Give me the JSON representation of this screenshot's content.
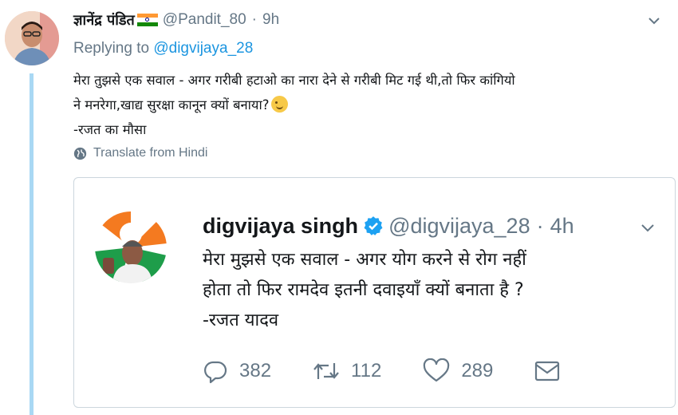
{
  "reply": {
    "author_name": "ज्ञानेंद्र पंडित",
    "handle": "@Pandit_80",
    "separator": "·",
    "time": "9h",
    "replying_prefix": "Replying to",
    "replying_to": "@digvijaya_28",
    "text_lines": [
      "मेरा तुझसे एक सवाल - अगर गरीबी हटाओ का नारा देने से गरीबी मिट गई थी,तो फिर कांगियो",
      "ने मनरेगा,खाद्य सुरक्षा कानून क्यों बनाया?",
      "-रजत का मौसा"
    ],
    "translate_label": "Translate from Hindi"
  },
  "quoted": {
    "author_name": "digvijaya singh",
    "handle": "@digvijaya_28",
    "separator": "·",
    "time": "4h",
    "text_lines": [
      "मेरा मुझसे एक सवाल - अगर योग करने से रोग नहीं",
      "होता तो फिर रामदेव इतनी दवाइयाँ क्यों बनाता है ?",
      "-रजत यादव"
    ],
    "replies": "382",
    "retweets": "112",
    "likes": "289"
  },
  "icons": {
    "flag": "india-flag-icon",
    "caret": "chevron-down-icon",
    "globe": "globe-icon",
    "verified": "verified-badge-icon",
    "reply": "reply-icon",
    "retweet": "retweet-icon",
    "like": "heart-icon",
    "dm": "envelope-icon",
    "emoji": "winking-face-icon"
  },
  "colors": {
    "link": "#1b95e0",
    "muted": "#657786",
    "thread_line": "#a9d8f4",
    "verified": "#1da1f2",
    "border": "#ccd6dd"
  }
}
